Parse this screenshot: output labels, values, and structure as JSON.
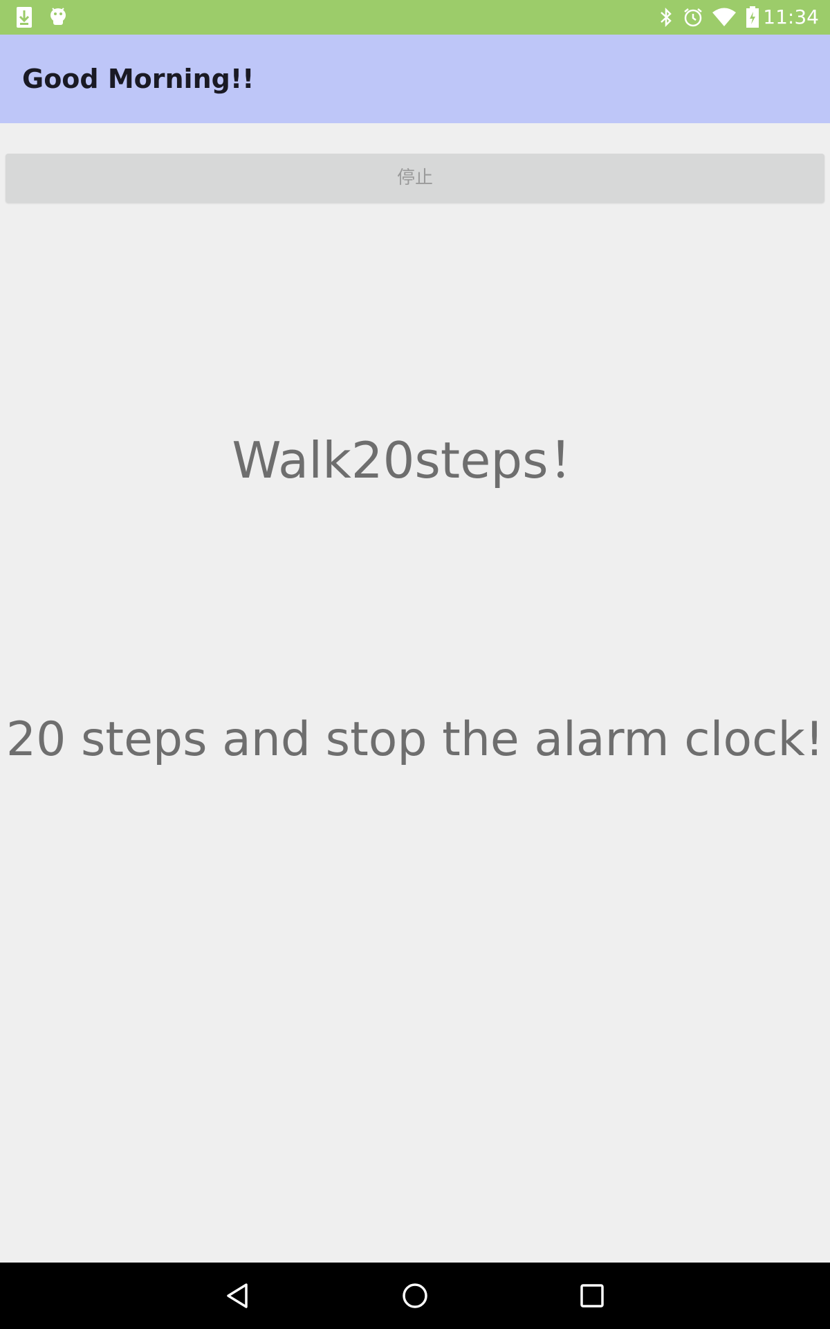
{
  "status_bar": {
    "time": "11:34",
    "left_icons": [
      "download-icon",
      "android-icon"
    ],
    "right_icons": [
      "bluetooth-icon",
      "alarm-icon",
      "wifi-icon",
      "battery-icon"
    ],
    "color": "#9ccc6a"
  },
  "app_bar": {
    "title": "Good Morning!!",
    "color": "#bec6f8"
  },
  "main": {
    "stop_button_label": "停止",
    "instruction": "Walk20steps！",
    "description": "20 steps and stop the alarm clock!"
  },
  "nav_bar": {
    "buttons": [
      "back-icon",
      "home-icon",
      "recents-icon"
    ]
  }
}
